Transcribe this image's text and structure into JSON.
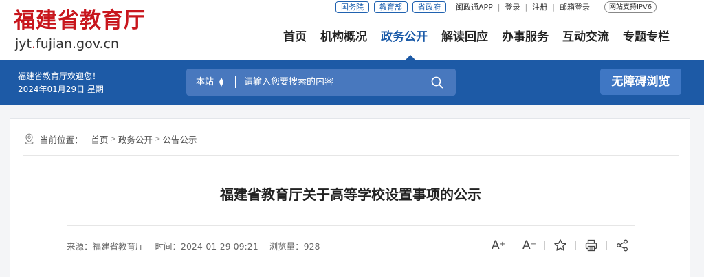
{
  "logo": {
    "cn": "福建省教育厅",
    "en_prefix": "jyt",
    "en_dot": ".",
    "en_suffix": "fujian.gov.cn"
  },
  "top_links": {
    "pills": [
      "国务院",
      "教育部",
      "省政府"
    ],
    "links": [
      "闽政通APP",
      "登录",
      "注册",
      "邮箱登录"
    ],
    "separator": "|",
    "ipv6": "网站支持IPV6"
  },
  "nav": {
    "items": [
      "首页",
      "机构概况",
      "政务公开",
      "解读回应",
      "办事服务",
      "互动交流",
      "专题专栏"
    ],
    "active": "政务公开"
  },
  "welcome": {
    "line1": "福建省教育厅欢迎您！",
    "line2": "2024年01月29日 星期一"
  },
  "search": {
    "scope": "本站",
    "placeholder": "请输入您要搜索的内容"
  },
  "accessibility": {
    "label": "无障碍浏览"
  },
  "breadcrumb": {
    "label": "当前位置：",
    "items": [
      "首页",
      "政务公开",
      "公告公示"
    ],
    "separator": ">"
  },
  "article": {
    "title": "福建省教育厅关于高等学校设置事项的公示",
    "source": "来源：福建省教育厅",
    "time": "时间：2024-01-29 09:21",
    "views": "浏览量：928"
  },
  "tools": {
    "font_plus": "A",
    "font_minus": "A",
    "plus_sign": "+",
    "minus_sign": "−"
  },
  "colors": {
    "brand_red": "#c8161d",
    "primary_blue": "#1d5aa6",
    "active_nav": "#1a5aa8"
  }
}
